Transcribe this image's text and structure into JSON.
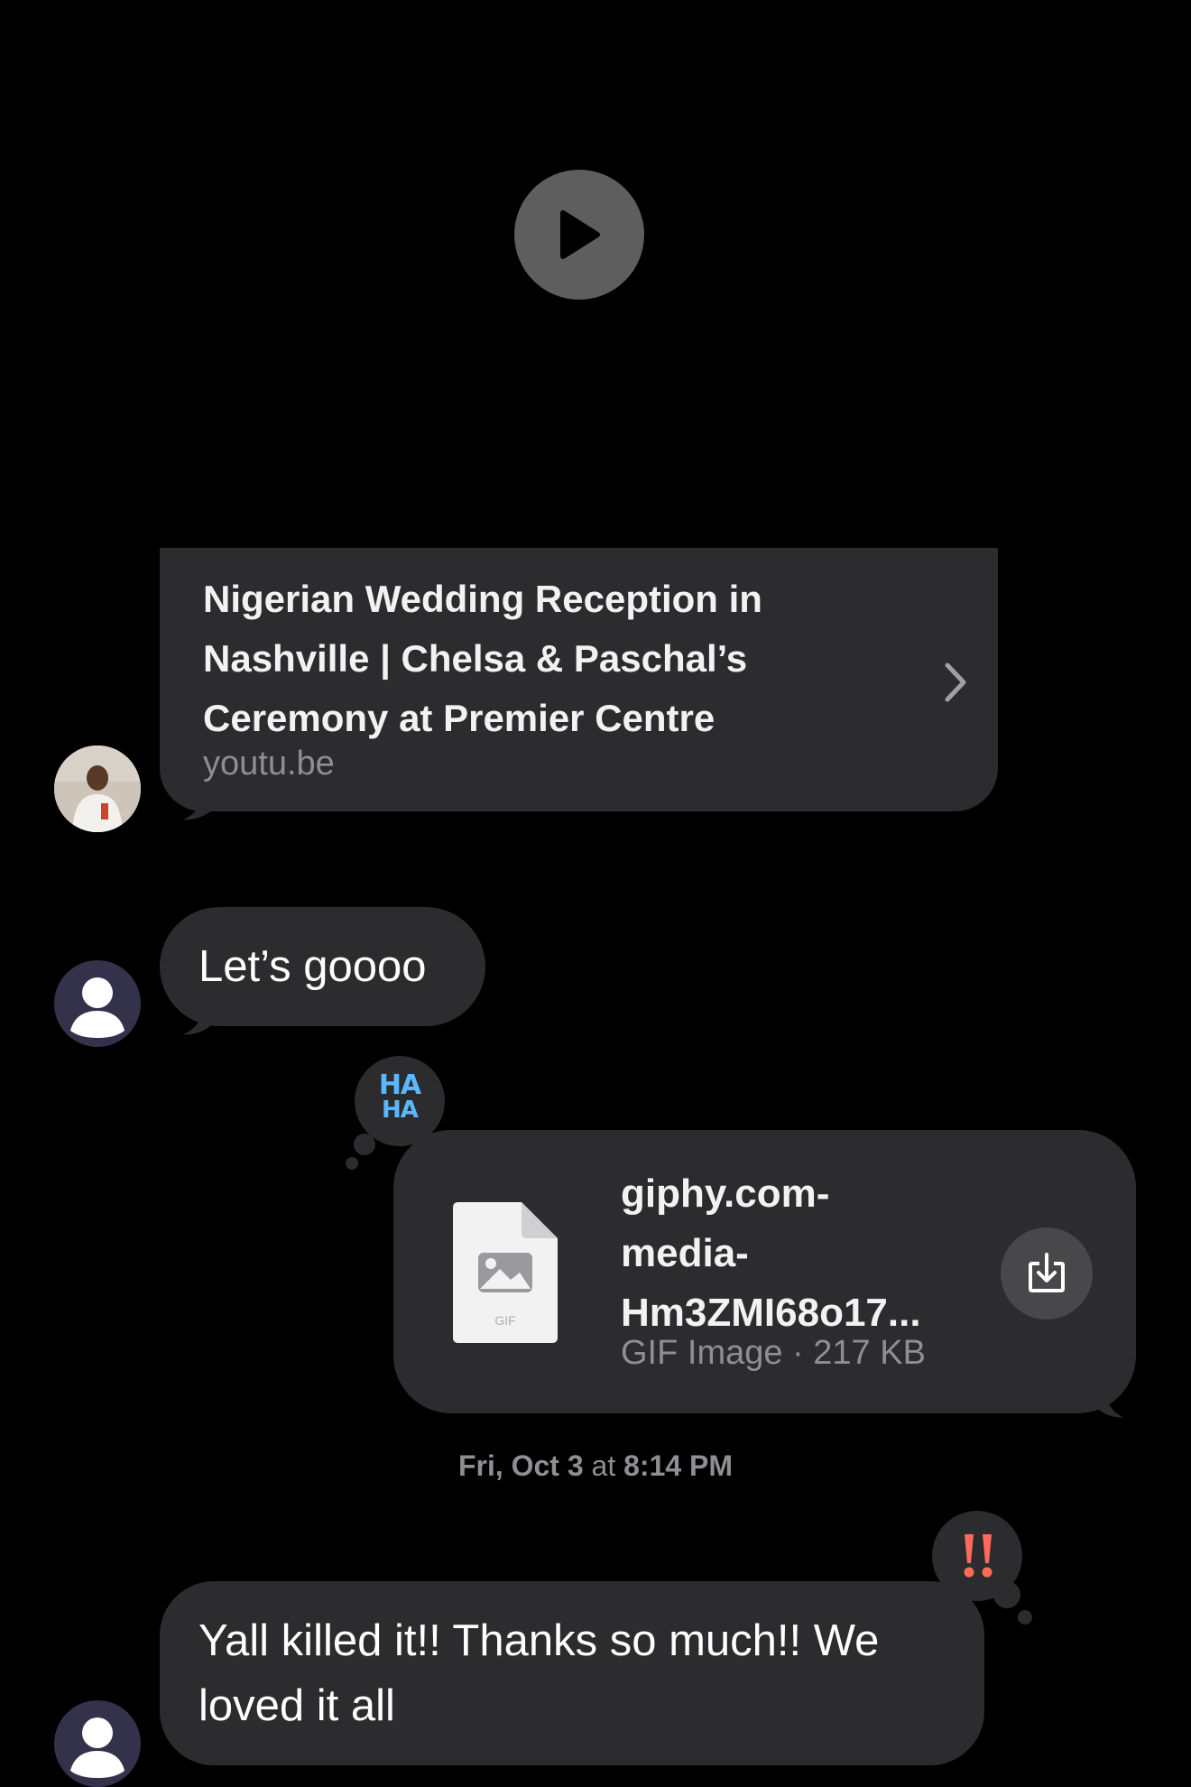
{
  "video": {
    "play_icon": "play-icon"
  },
  "link_preview": {
    "title": "Nigerian Wedding Reception in Nashville | Chelsa & Paschal’s Ceremony at Premier Centre",
    "domain": "youtu.be",
    "chevron_icon": "chevron-right-icon"
  },
  "messages": [
    {
      "text": "Let’s goooo"
    },
    {
      "attachment": {
        "file_name": "giphy.com-media-Hm3ZMI68o17...",
        "file_name_lines": [
          "giphy.com-",
          "media-",
          "Hm3ZMI68o17..."
        ],
        "file_meta": "GIF Image · 217 KB",
        "thumb_label": "GIF",
        "reaction": "HA HA",
        "reaction_lines": [
          "HA",
          "HA"
        ]
      }
    },
    {
      "text": "Yall killed it!! Thanks so much!! We loved it all",
      "text_lines": [
        "Yall killed it!! Thanks so much!! We",
        "loved it all"
      ],
      "reaction": "‼️"
    }
  ],
  "timestamp": {
    "day": "Fri, Oct 3",
    "at": "at",
    "time": "8:14 PM"
  },
  "colors": {
    "background": "#000000",
    "bubble": "#2c2c2e",
    "secondary_text": "#8e8e93",
    "haha": "#5ab8ff",
    "exclamation": "#ff6b5a"
  }
}
